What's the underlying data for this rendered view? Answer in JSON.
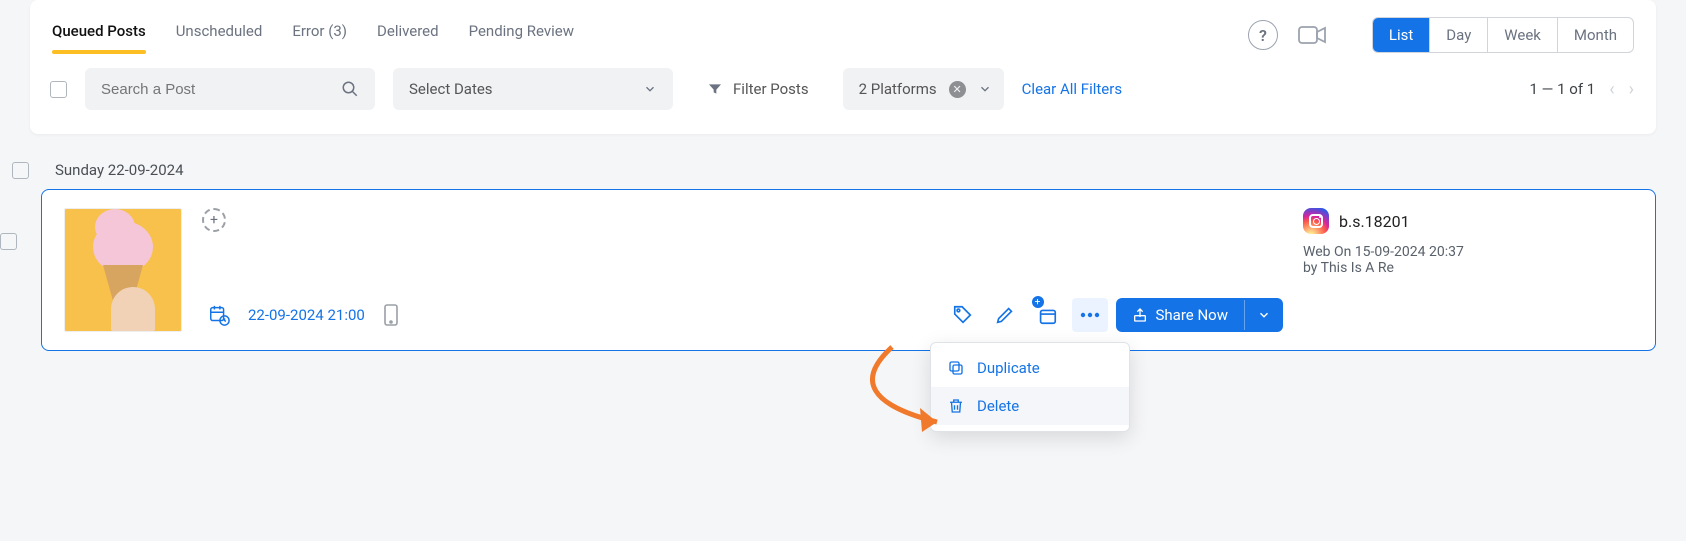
{
  "tabs": {
    "queued": "Queued Posts",
    "unscheduled": "Unscheduled",
    "error": "Error (3)",
    "delivered": "Delivered",
    "pending": "Pending Review"
  },
  "views": {
    "list": "List",
    "day": "Day",
    "week": "Week",
    "month": "Month"
  },
  "filters": {
    "search_placeholder": "Search a Post",
    "dates": "Select Dates",
    "filter_posts": "Filter Posts",
    "platforms": "2 Platforms",
    "clear": "Clear All Filters"
  },
  "pagination": "1 — 1 of 1",
  "date_header": "Sunday 22-09-2024",
  "post": {
    "datetime": "22-09-2024 21:00",
    "share": "Share Now"
  },
  "account": {
    "name": "b.s.18201",
    "meta1": "Web On 15-09-2024 20:37",
    "meta2": "by This Is A Re"
  },
  "menu": {
    "duplicate": "Duplicate",
    "delete": "Delete"
  }
}
